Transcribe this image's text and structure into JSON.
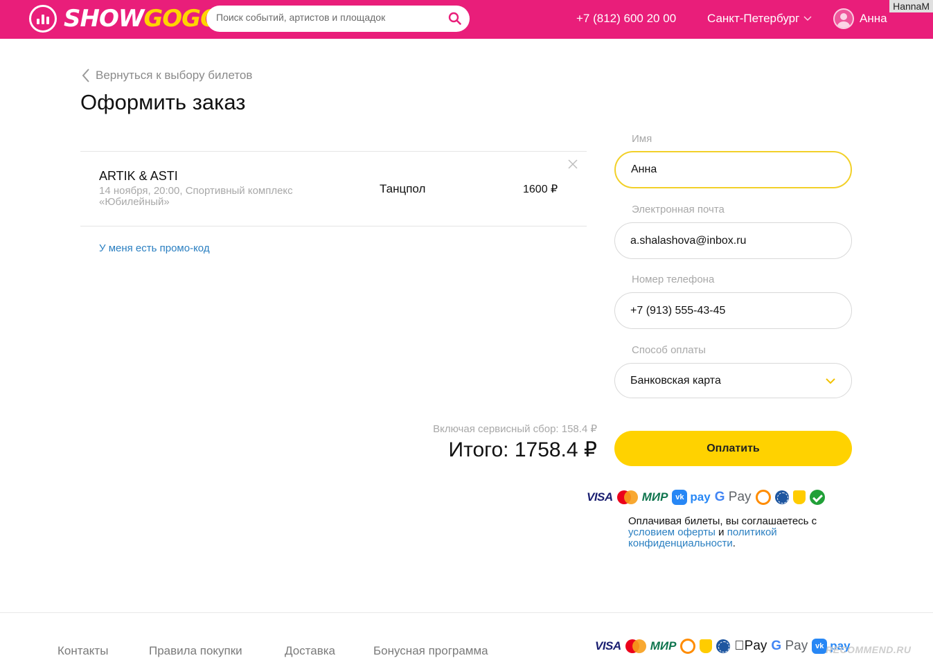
{
  "header": {
    "logo_show": "SHOW",
    "logo_gogo": "GOGO",
    "search_placeholder": "Поиск событий, артистов и площадок",
    "phone": "+7 (812) 600 20 00",
    "city": "Санкт-Петербург",
    "user_name": "Анна",
    "watermark_user": "HannaM"
  },
  "nav": {
    "back_label": "Вернуться к выбору билетов",
    "page_title": "Оформить заказ"
  },
  "order": {
    "event_name": "ARTIK & ASTI",
    "event_info": "14 ноября, 20:00, Спортивный комплекс «Юбилейный»",
    "zone": "Танцпол",
    "price": "1600 ₽",
    "promo_link": "У меня есть промо-код"
  },
  "form": {
    "name_label": "Имя",
    "name_value": "Анна",
    "email_label": "Электронная почта",
    "email_value": "a.shalashova@inbox.ru",
    "phone_label": "Номер телефона",
    "phone_value": "+7 (913) 555-43-45",
    "payment_label": "Способ оплаты",
    "payment_value": "Банковская карта"
  },
  "summary": {
    "fee_text": "Включая сервисный сбор: 158.4 ₽",
    "total_text": "Итого: 1758.4 ₽",
    "pay_button": "Оплатить"
  },
  "payment_logos": {
    "visa": "VISA",
    "mir": "МИР",
    "vk": "vk",
    "vk_pay": "pay",
    "g_pay": "Pay",
    "apple_pay": "Pay"
  },
  "terms": {
    "prefix": "Оплачивая билеты, вы соглашаетесь с",
    "offer_link": "условием оферты",
    "and": "и",
    "privacy_link": "политикой конфиденциальности",
    "suffix": "."
  },
  "footer": {
    "contacts": "Контакты",
    "rules": "Правила покупки",
    "delivery": "Доставка",
    "bonus": "Бонусная программа",
    "watermark": "RECOMMEND.RU"
  },
  "colors": {
    "brand": "#e91e7a",
    "accent_yellow": "#ffd200",
    "link_blue": "#2a7fc1"
  }
}
